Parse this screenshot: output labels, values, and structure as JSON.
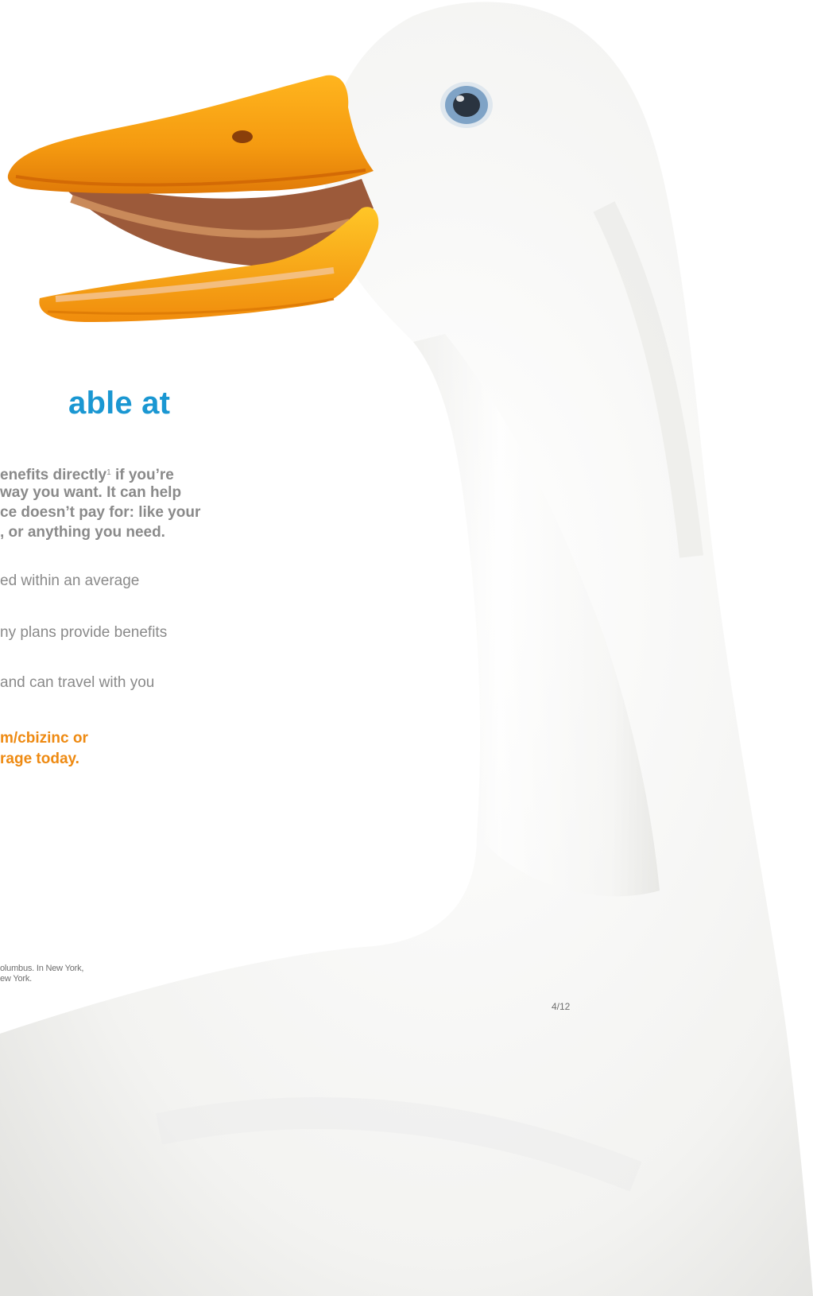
{
  "heading": "able at",
  "intro": {
    "line1": {
      "before": "enefits directly",
      "sup": "1",
      "after": " if you’re"
    },
    "line2": "way you want. It can help",
    "line3": "ce doesn’t pay for: like your",
    "line4": ", or anything you need."
  },
  "bullets": [
    "ed within an average",
    "ny plans provide benefits",
    "and can travel with you"
  ],
  "cta": [
    "m/cbizinc or",
    "rage today."
  ],
  "fineprint": [
    "olumbus. In New York,",
    "ew York."
  ],
  "page_code": "4/12",
  "colors": {
    "heading": "#1a97d2",
    "cta": "#ee8a12",
    "body_text": "#8a8a8a"
  }
}
